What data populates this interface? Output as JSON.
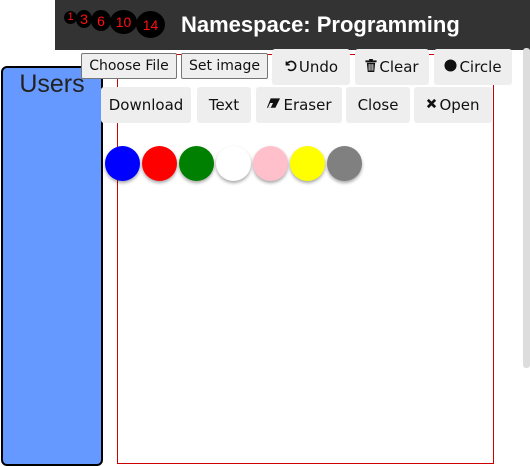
{
  "header": {
    "badges": [
      "1",
      "3",
      "6",
      "10",
      "14"
    ],
    "title": "Namespace: Programming"
  },
  "users": {
    "title": "Users"
  },
  "file_input": {
    "choose_label": "Choose File",
    "set_image_label": "Set image"
  },
  "toolbar": {
    "undo": "Undo",
    "clear": "Clear",
    "circle": "Circle",
    "download": "Download",
    "text": "Text",
    "eraser": "Eraser",
    "close": "Close",
    "open": "Open"
  },
  "icons": {
    "undo": "undo-icon",
    "clear": "trash-icon",
    "circle": "circle-icon",
    "eraser": "eraser-icon",
    "open": "x-icon"
  },
  "palette": [
    "#0000ff",
    "#ff0000",
    "#008000",
    "#ffffff",
    "#ffc0cb",
    "#ffff00",
    "#808080"
  ],
  "colors": {
    "header_bg": "#333333",
    "badge_text": "#ff1111",
    "users_panel": "#6699ff",
    "canvas_border": "#cc0000"
  }
}
